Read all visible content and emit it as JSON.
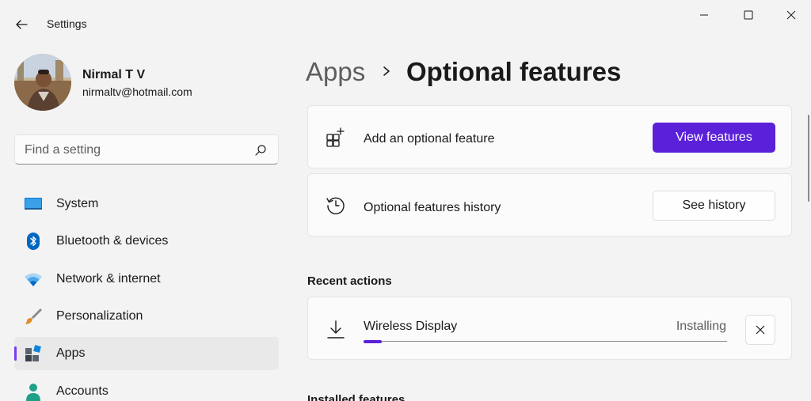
{
  "window": {
    "title": "Settings",
    "controls": [
      "minimize-icon",
      "maximize-icon",
      "close-icon"
    ]
  },
  "user": {
    "name": "Nirmal T V",
    "email": "nirmaltv@hotmail.com"
  },
  "search": {
    "placeholder": "Find a setting",
    "value": ""
  },
  "nav": {
    "items": [
      {
        "label": "System",
        "icon": "monitor-icon",
        "selected": false
      },
      {
        "label": "Bluetooth & devices",
        "icon": "bluetooth-icon",
        "selected": false
      },
      {
        "label": "Network & internet",
        "icon": "wifi-icon",
        "selected": false
      },
      {
        "label": "Personalization",
        "icon": "brush-icon",
        "selected": false
      },
      {
        "label": "Apps",
        "icon": "apps-icon",
        "selected": true
      },
      {
        "label": "Accounts",
        "icon": "person-icon",
        "selected": false
      }
    ]
  },
  "breadcrumb": {
    "parent": "Apps",
    "current": "Optional features"
  },
  "cards": {
    "add": {
      "label": "Add an optional feature",
      "button": "View features",
      "icon": "add-grid-icon"
    },
    "history": {
      "label": "Optional features history",
      "button": "See history",
      "icon": "history-icon"
    }
  },
  "recent": {
    "title": "Recent actions",
    "item": {
      "name": "Wireless Display",
      "status": "Installing",
      "progress": 0.05,
      "icon": "download-icon"
    }
  },
  "installed": {
    "title": "Installed features"
  },
  "colors": {
    "accent": "#5b21d9",
    "selection_bar": "#7a3cf0",
    "background": "#f3f3f3",
    "card": "#fbfbfb"
  }
}
